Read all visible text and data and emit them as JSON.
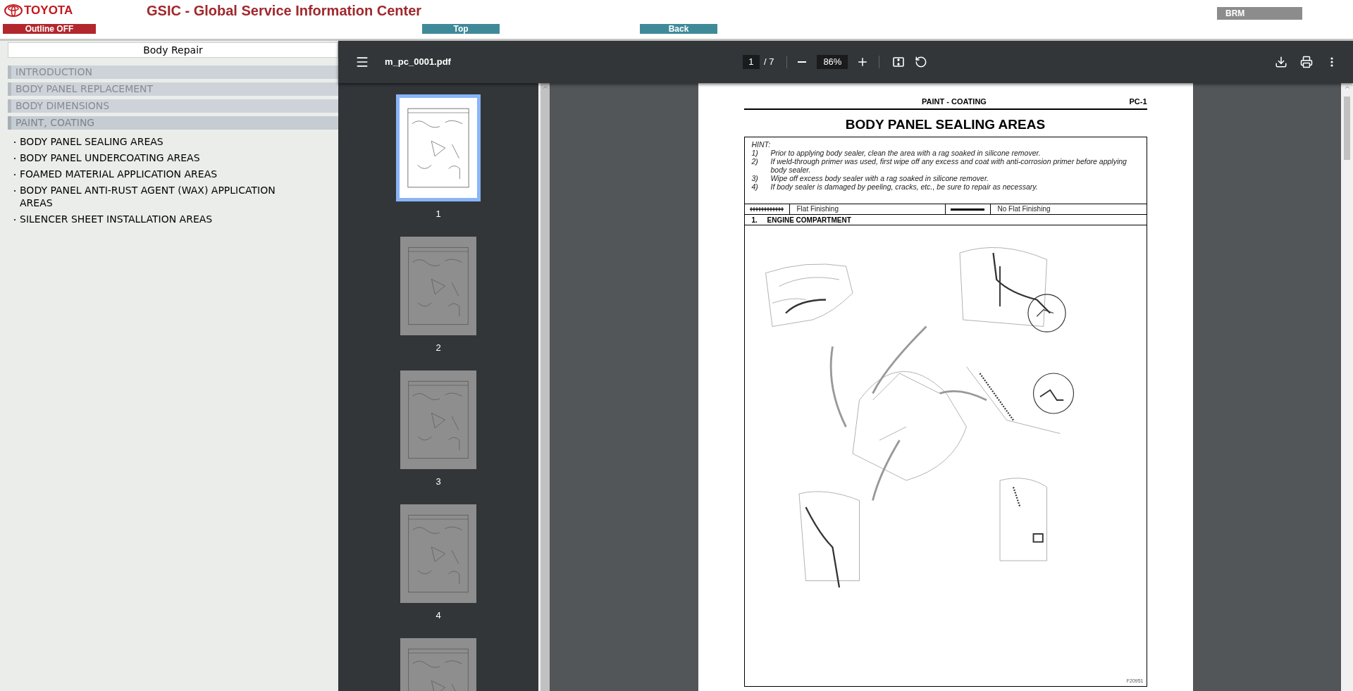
{
  "header": {
    "brand": "TOYOTA",
    "title": "GSIC - Global Service Information Center",
    "buttons": [
      {
        "kind": "outline",
        "label": "Outline OFF"
      },
      {
        "kind": "nav",
        "label": "Top"
      },
      {
        "kind": "nav",
        "label": "Back"
      }
    ],
    "code": "BRM"
  },
  "sidebar": {
    "title": "Body Repair",
    "sections": [
      {
        "label": "INTRODUCTION",
        "expanded": false
      },
      {
        "label": "BODY PANEL REPLACEMENT",
        "expanded": false
      },
      {
        "label": "BODY DIMENSIONS",
        "expanded": false
      },
      {
        "label": "PAINT, COATING",
        "expanded": true,
        "children": [
          {
            "label": "BODY PANEL SEALING AREAS"
          },
          {
            "label": "BODY PANEL UNDERCOATING AREAS"
          },
          {
            "label": "FOAMED MATERIAL APPLICATION AREAS"
          },
          {
            "label": "BODY PANEL ANTI-RUST AGENT (WAX) APPLICATION AREAS"
          },
          {
            "label": "SILENCER SHEET INSTALLATION AREAS"
          }
        ]
      }
    ]
  },
  "viewer": {
    "file_name": "m_pc_0001.pdf",
    "page": "1",
    "page_count": "/ 7",
    "zoom": "86%",
    "thumbnails": [
      {
        "label": "1",
        "selected": true
      },
      {
        "label": "2",
        "selected": false
      },
      {
        "label": "3",
        "selected": false
      },
      {
        "label": "4",
        "selected": false
      },
      {
        "selected": false
      }
    ],
    "document": {
      "section": "PAINT - COATING",
      "page_code": "PC-1",
      "title": "BODY PANEL SEALING AREAS",
      "hint_label": "HINT:",
      "hints": [
        {
          "number": "1)",
          "text": "Prior to applying body sealer, clean the area with a rag soaked in silicone remover."
        },
        {
          "number": "2)",
          "text": "If weld-through primer was used, first wipe off any excess and coat with anti-corrosion primer before applying body sealer."
        },
        {
          "number": "3)",
          "text": "Wipe off excess body sealer with a rag soaked in silicone remover."
        },
        {
          "number": "4)",
          "text": "If body sealer is damaged by peeling, cracks, etc., be sure to repair as necessary."
        }
      ],
      "legend": [
        {
          "kind": "hatched",
          "label": "Flat Finishing"
        },
        {
          "kind": "solid",
          "label": "No Flat Finishing"
        }
      ],
      "step_number": "1.",
      "step_title": "ENGINE COMPARTMENT",
      "figure_code": "F20951"
    }
  }
}
